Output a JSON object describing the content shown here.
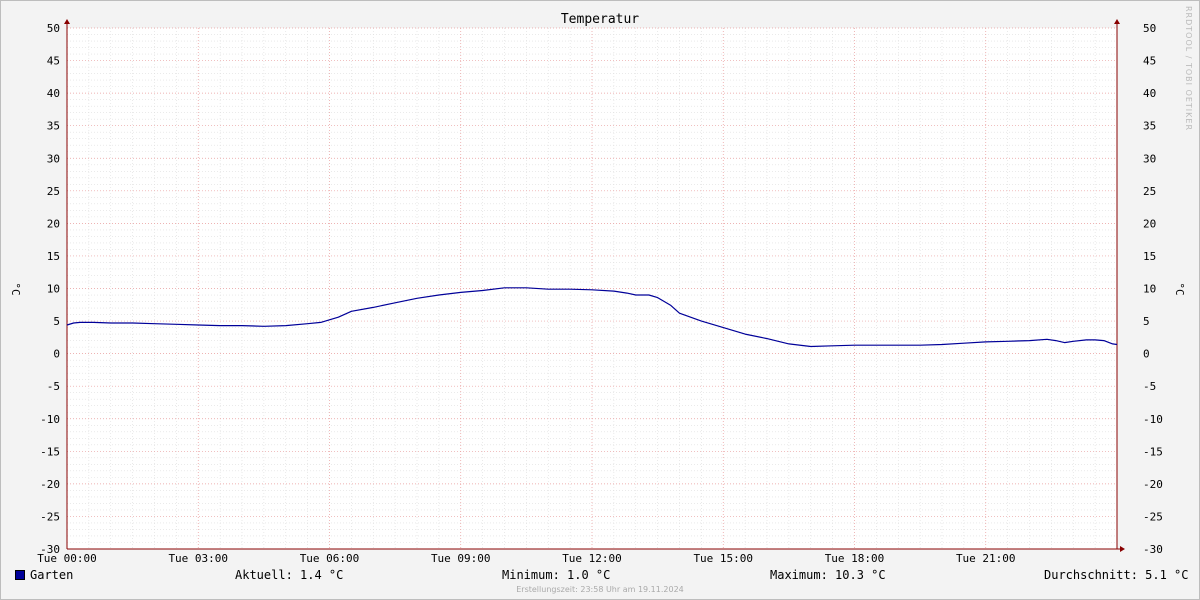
{
  "colors": {
    "series": "#000099",
    "minor_grid": "#dddddd",
    "major_grid": "#e89a9a",
    "axis": "#880000"
  },
  "watermark": "RRDTOOL / TOBI OETIKER",
  "legend": {
    "series_name": "Garten",
    "current": "Aktuell: 1.4 °C",
    "minimum": "Minimum: 1.0 °C",
    "maximum": "Maximum: 10.3 °C",
    "average": "Durchschnitt: 5.1 °C"
  },
  "credit": "Erstellungszeit: 23:58 Uhr am 19.11.2024",
  "chart_data": {
    "type": "line",
    "title": "Temperatur",
    "ylabel": "°C",
    "ylabel_right": "°C",
    "ylim": [
      -30,
      50
    ],
    "xlim": [
      0,
      24
    ],
    "y_ticks": [
      -30,
      -25,
      -20,
      -15,
      -10,
      -5,
      0,
      5,
      10,
      15,
      20,
      25,
      30,
      35,
      40,
      45,
      50
    ],
    "x_ticks": [
      {
        "value": 0,
        "label": "Tue 00:00"
      },
      {
        "value": 3,
        "label": "Tue 03:00"
      },
      {
        "value": 6,
        "label": "Tue 06:00"
      },
      {
        "value": 9,
        "label": "Tue 09:00"
      },
      {
        "value": 12,
        "label": "Tue 12:00"
      },
      {
        "value": 15,
        "label": "Tue 15:00"
      },
      {
        "value": 18,
        "label": "Tue 18:00"
      },
      {
        "value": 21,
        "label": "Tue 21:00"
      }
    ],
    "grid": true,
    "series": [
      {
        "name": "Garten",
        "x": [
          0.0,
          0.15,
          0.3,
          0.6,
          1.0,
          1.5,
          2.0,
          2.5,
          3.0,
          3.5,
          4.0,
          4.5,
          5.0,
          5.5,
          5.8,
          6.0,
          6.2,
          6.5,
          7.0,
          7.5,
          8.0,
          8.5,
          9.0,
          9.5,
          10.0,
          10.5,
          11.0,
          11.5,
          12.0,
          12.5,
          12.8,
          13.0,
          13.3,
          13.5,
          13.8,
          14.0,
          14.5,
          15.0,
          15.5,
          16.0,
          16.5,
          17.0,
          17.5,
          18.0,
          18.5,
          19.0,
          19.5,
          20.0,
          20.5,
          21.0,
          21.5,
          22.0,
          22.4,
          22.6,
          22.8,
          23.0,
          23.3,
          23.5,
          23.7,
          23.9,
          24.0
        ],
        "y": [
          4.4,
          4.7,
          4.8,
          4.8,
          4.7,
          4.7,
          4.6,
          4.5,
          4.4,
          4.3,
          4.3,
          4.2,
          4.3,
          4.6,
          4.8,
          5.2,
          5.6,
          6.5,
          7.1,
          7.8,
          8.5,
          9.0,
          9.4,
          9.7,
          10.1,
          10.1,
          9.9,
          9.9,
          9.8,
          9.6,
          9.3,
          9.0,
          9.0,
          8.6,
          7.4,
          6.2,
          5.0,
          4.0,
          3.0,
          2.3,
          1.5,
          1.1,
          1.2,
          1.3,
          1.3,
          1.3,
          1.3,
          1.4,
          1.6,
          1.8,
          1.9,
          2.0,
          2.2,
          2.0,
          1.7,
          1.9,
          2.1,
          2.1,
          2.0,
          1.5,
          1.4
        ]
      }
    ]
  }
}
